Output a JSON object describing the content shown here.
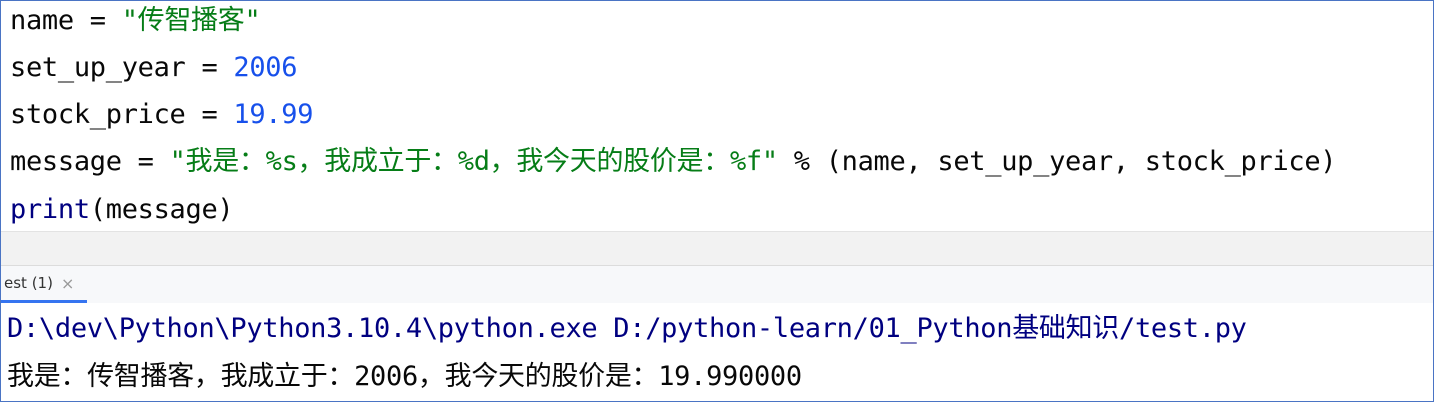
{
  "editor": {
    "lines": [
      {
        "tokens": [
          "name",
          " = ",
          "\"传智播客\""
        ]
      },
      {
        "tokens": [
          "set_up_year",
          " = ",
          "2006"
        ]
      },
      {
        "tokens": [
          "stock_price",
          " = ",
          "19.99"
        ]
      },
      {
        "tokens": [
          "message",
          " = ",
          "\"我是：%s，我成立于：%d，我今天的股价是：%f\"",
          " % (name, set_up_year, stock_price)"
        ]
      },
      {
        "tokens": [
          "print",
          "(message)"
        ]
      }
    ]
  },
  "run_panel": {
    "tab_label": "est (1)",
    "close_glyph": "×"
  },
  "console": {
    "command_line": "D:\\dev\\Python\\Python3.10.4\\python.exe D:/python-learn/01_Python基础知识/test.py",
    "output_line": "我是：传智播客，我成立于：2006，我今天的股价是：19.990000"
  },
  "colors": {
    "string": "#067d17",
    "number": "#1750eb",
    "builtin": "#000080",
    "tab_underline": "#3574f0"
  }
}
